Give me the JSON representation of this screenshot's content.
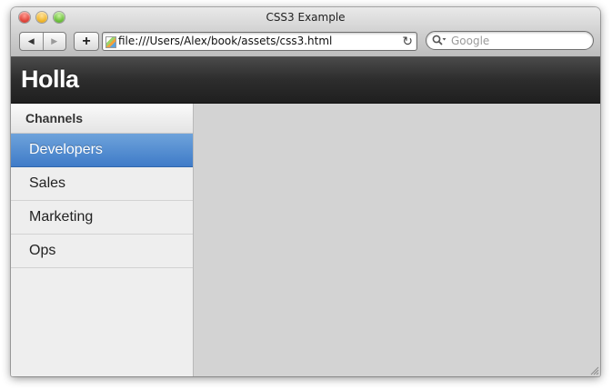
{
  "window": {
    "title": "CSS3 Example",
    "url": "file:///Users/Alex/book/assets/css3.html",
    "search_placeholder": "Google"
  },
  "toolbar": {
    "back_icon": "back-arrow-icon",
    "forward_icon": "forward-arrow-icon",
    "add_label": "+",
    "reload_icon": "reload-icon"
  },
  "app": {
    "title": "Holla"
  },
  "sidebar": {
    "header": "Channels",
    "items": [
      {
        "label": "Developers",
        "active": true
      },
      {
        "label": "Sales",
        "active": false
      },
      {
        "label": "Marketing",
        "active": false
      },
      {
        "label": "Ops",
        "active": false
      }
    ]
  },
  "colors": {
    "active_channel": "#4a86cf",
    "appbar": "#2d2d2d",
    "content_bg": "#d3d3d3"
  }
}
